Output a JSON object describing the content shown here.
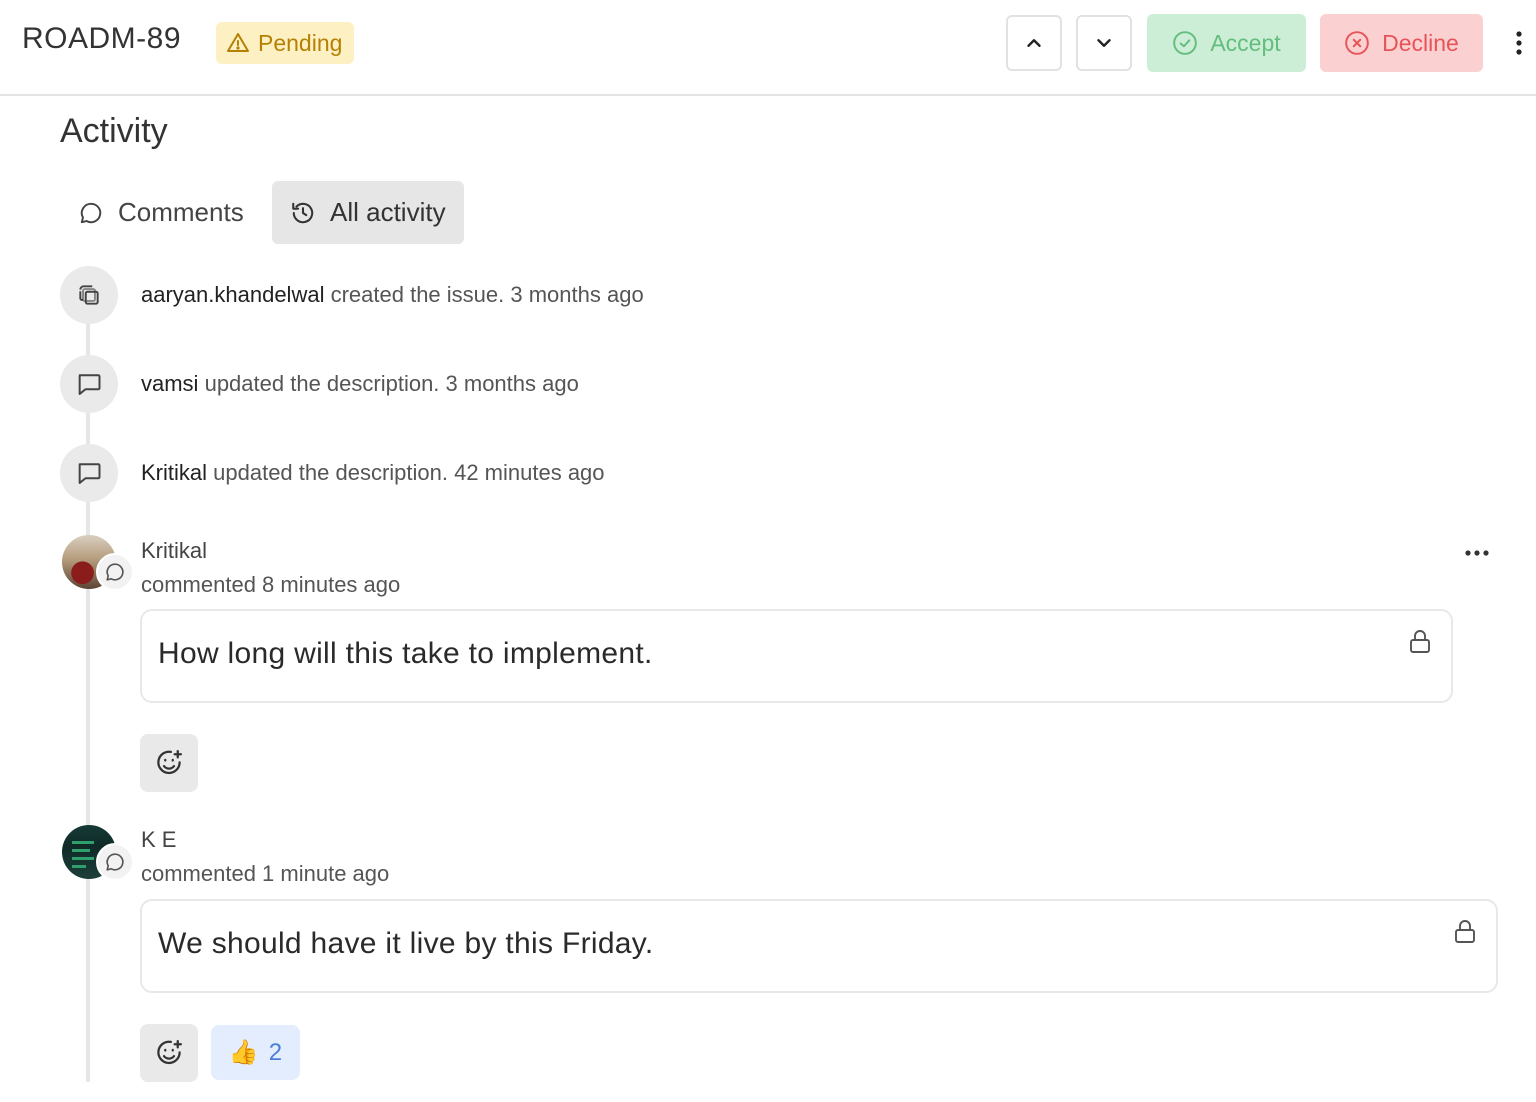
{
  "header": {
    "issue_key": "ROADM-89",
    "status": "Pending",
    "accept_label": "Accept",
    "decline_label": "Decline"
  },
  "activity": {
    "title": "Activity",
    "tabs": [
      {
        "label": "Comments",
        "icon": "comment-icon",
        "active": false
      },
      {
        "label": "All activity",
        "icon": "history-icon",
        "active": true
      }
    ]
  },
  "events": [
    {
      "user": "aaryan.khandelwal",
      "text": "created the issue. 3 months ago",
      "icon": "layers-icon"
    },
    {
      "user": "vamsi",
      "text": "updated the description. 3 months ago",
      "icon": "message-square-icon"
    },
    {
      "user": "Kritikal",
      "text": "updated the description. 42 minutes ago",
      "icon": "message-square-icon"
    }
  ],
  "comments": [
    {
      "author": "Kritikal",
      "meta": "commented 8 minutes ago",
      "body": "How long will this take to implement.",
      "reactions": []
    },
    {
      "author": "K E",
      "meta": "commented 1 minute ago",
      "body": "We should have it live by this Friday.",
      "reactions": [
        {
          "emoji": "👍",
          "count": "2"
        }
      ]
    }
  ],
  "colors": {
    "pending_bg": "#fdf0c2",
    "pending_text": "#b58105",
    "accept_bg": "#cdeed6",
    "accept_text": "#63bd7c",
    "decline_bg": "#fbd0d0",
    "decline_text": "#e6545a",
    "reaction_bg": "#e3edfd"
  }
}
